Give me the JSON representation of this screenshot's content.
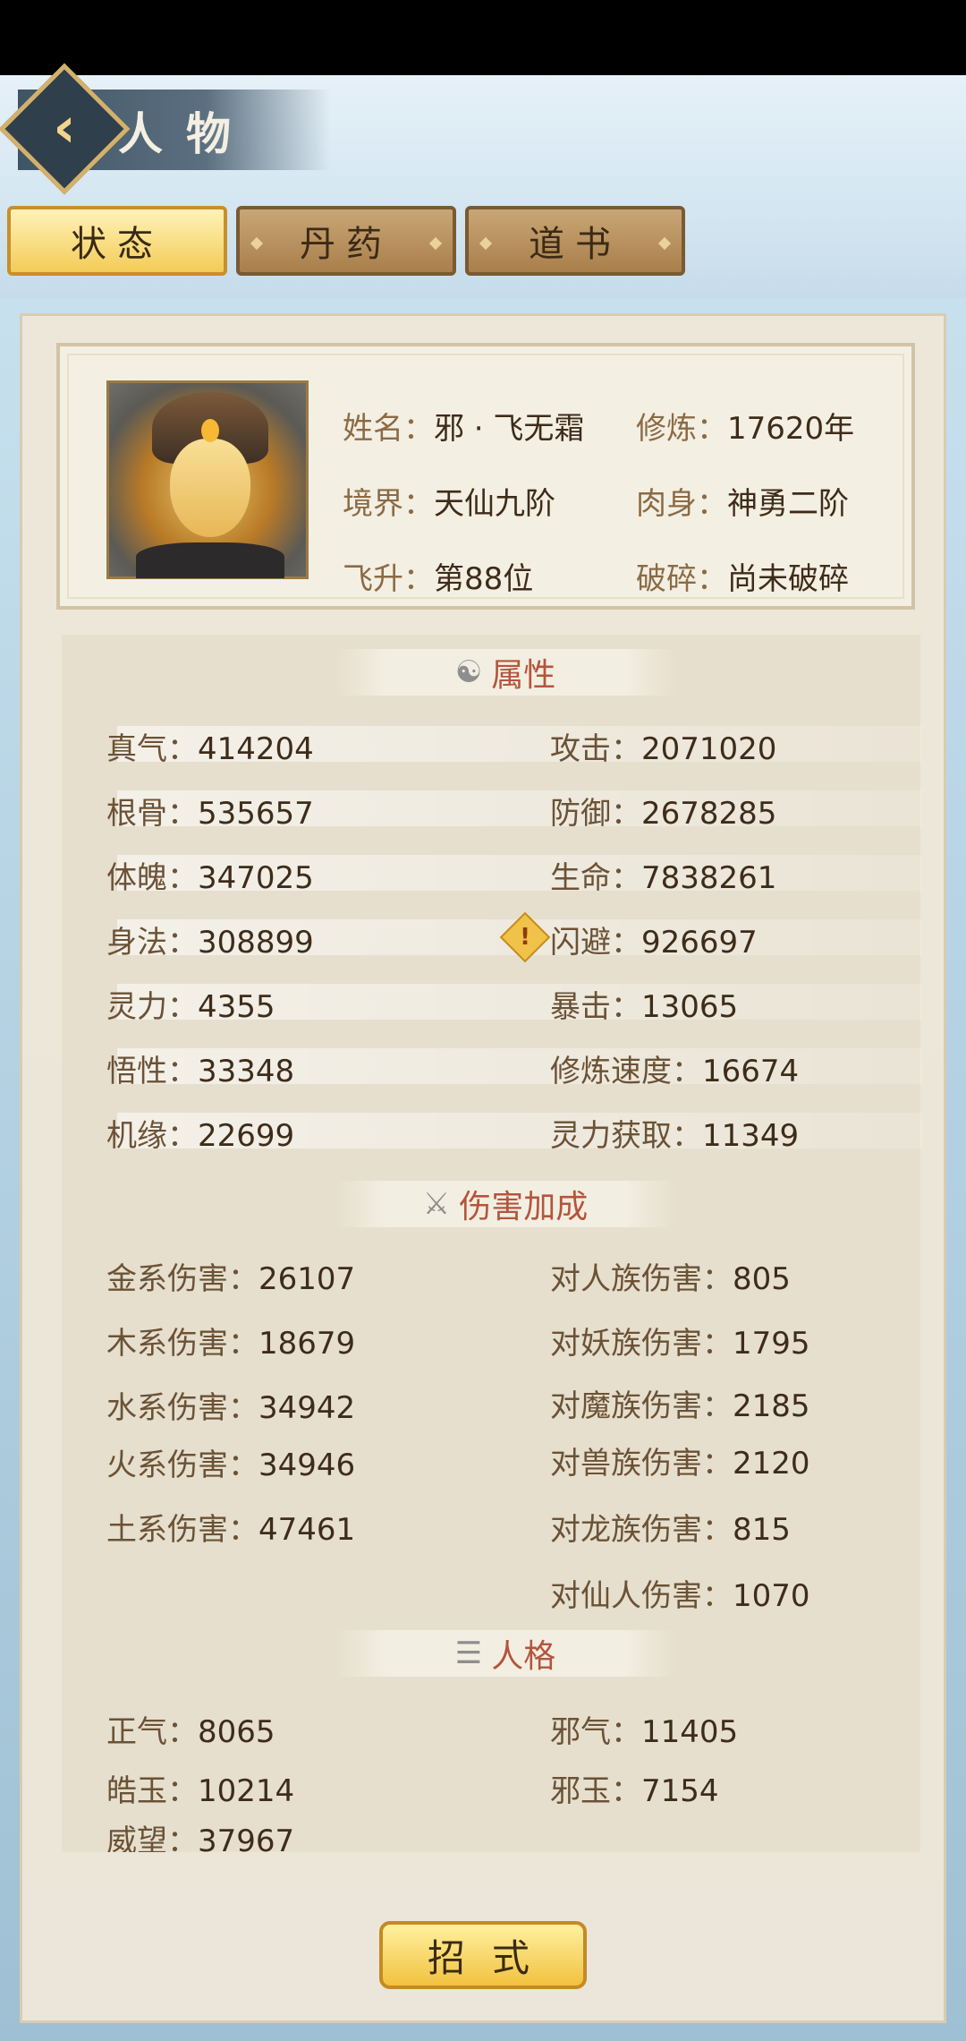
{
  "header": {
    "title": "人物"
  },
  "tabs": [
    {
      "label": "状态",
      "active": true
    },
    {
      "label": "丹药",
      "active": false
    },
    {
      "label": "道书",
      "active": false
    }
  ],
  "profile": {
    "name_label": "姓名：",
    "name": "邪 · 飞无霜",
    "cultivation_label": "修炼：",
    "cultivation": "17620年",
    "realm_label": "境界：",
    "realm": "天仙九阶",
    "body_label": "肉身：",
    "body": "神勇二阶",
    "ascend_label": "飞升：",
    "ascend": "第88位",
    "shatter_label": "破碎：",
    "shatter": "尚未破碎"
  },
  "sections": {
    "attributes": "属性",
    "damage": "伤害加成",
    "personality": "人格"
  },
  "attributes": {
    "left": [
      {
        "label": "真气：",
        "value": "414204"
      },
      {
        "label": "根骨：",
        "value": "535657"
      },
      {
        "label": "体魄：",
        "value": "347025"
      },
      {
        "label": "身法：",
        "value": "308899"
      },
      {
        "label": "灵力：",
        "value": "4355"
      },
      {
        "label": "悟性：",
        "value": "33348"
      },
      {
        "label": "机缘：",
        "value": "22699"
      }
    ],
    "right": [
      {
        "label": "攻击：",
        "value": "2071020"
      },
      {
        "label": "防御：",
        "value": "2678285"
      },
      {
        "label": "生命：",
        "value": "7838261"
      },
      {
        "label": "闪避：",
        "value": "926697"
      },
      {
        "label": "暴击：",
        "value": "13065"
      },
      {
        "label": "修炼速度：",
        "value": "16674"
      },
      {
        "label": "灵力获取：",
        "value": "11349"
      }
    ]
  },
  "damage": {
    "left": [
      {
        "label": "金系伤害：",
        "value": "26107"
      },
      {
        "label": "木系伤害：",
        "value": "18679"
      },
      {
        "label": "水系伤害：",
        "value": "34942"
      },
      {
        "label": "火系伤害：",
        "value": "34946"
      },
      {
        "label": "土系伤害：",
        "value": "47461"
      }
    ],
    "right": [
      {
        "label": "对人族伤害：",
        "value": "805"
      },
      {
        "label": "对妖族伤害：",
        "value": "1795"
      },
      {
        "label": "对魔族伤害：",
        "value": "2185"
      },
      {
        "label": "对兽族伤害：",
        "value": "2120"
      },
      {
        "label": "对龙族伤害：",
        "value": "815"
      },
      {
        "label": "对仙人伤害：",
        "value": "1070"
      }
    ]
  },
  "personality": {
    "left": [
      {
        "label": "正气：",
        "value": "8065"
      },
      {
        "label": "皓玉：",
        "value": "10214"
      },
      {
        "label": "威望：",
        "value": "37967"
      }
    ],
    "right": [
      {
        "label": "邪气：",
        "value": "11405"
      },
      {
        "label": "邪玉：",
        "value": "7154"
      }
    ]
  },
  "skill_button": "招式",
  "warn_symbol": "!",
  "colors": {
    "accent_title": "#b4553c",
    "tab_active": "#f3cc57",
    "tab_inactive": "#a97f4b"
  }
}
